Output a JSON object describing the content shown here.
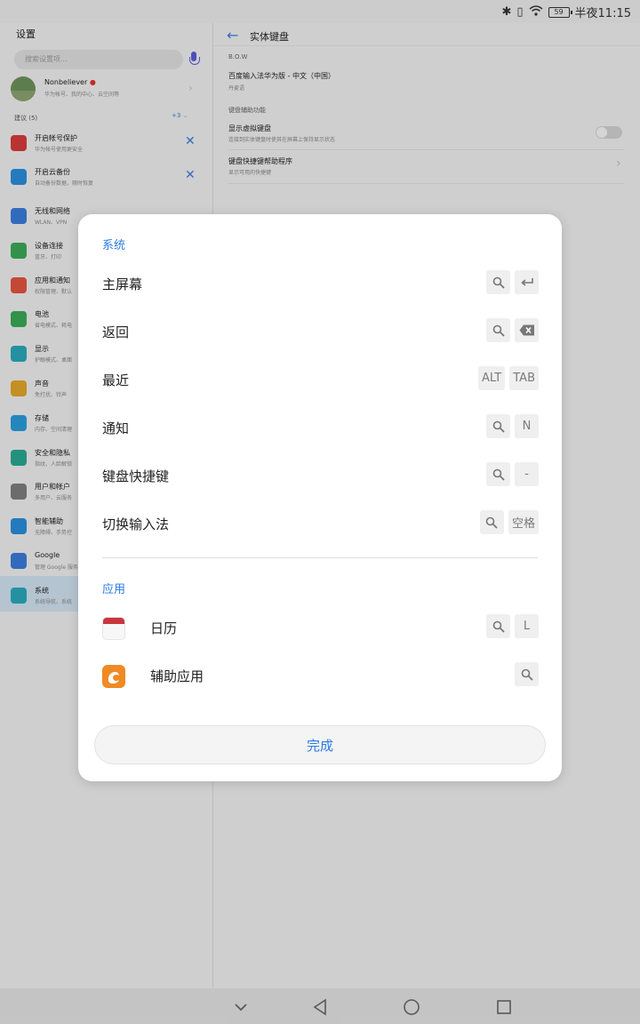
{
  "status_bar": {
    "battery": "59",
    "time": "半夜11:15"
  },
  "left_pane": {
    "title": "设置",
    "search_placeholder": "搜索设置项...",
    "profile": {
      "name": "Nonbeliever",
      "sub": "华为帐号、我的中心、云空间等"
    },
    "suggest": {
      "label": "建议 (5)",
      "more": "+3"
    },
    "suggestions": [
      {
        "title": "开启帐号保护",
        "sub": "华为帐号使用更安全"
      },
      {
        "title": "开启云备份",
        "sub": "自动备份数据，随时恢复"
      }
    ],
    "items": [
      {
        "title": "无线和网络",
        "sub": "WLAN、VPN",
        "color": "#3b7ad6"
      },
      {
        "title": "设备连接",
        "sub": "蓝牙、打印",
        "color": "#3aa756"
      },
      {
        "title": "应用和通知",
        "sub": "权限管理、默认",
        "color": "#e0523f"
      },
      {
        "title": "电池",
        "sub": "省电模式、耗电",
        "color": "#3aa756"
      },
      {
        "title": "显示",
        "sub": "护眼模式、桌面",
        "color": "#2aa6b7"
      },
      {
        "title": "声音",
        "sub": "免打扰、铃声",
        "color": "#e0a32a"
      },
      {
        "title": "存储",
        "sub": "内存、空间清理",
        "color": "#2a9ad6"
      },
      {
        "title": "安全和隐私",
        "sub": "指纹、人脸解锁",
        "color": "#2aa68f"
      },
      {
        "title": "用户和帐户",
        "sub": "多用户、云服务",
        "color": "#7b7b7b"
      },
      {
        "title": "智能辅助",
        "sub": "无障碍、手势控",
        "color": "#2a8bd6"
      },
      {
        "title": "Google",
        "sub": "管理 Google 服务",
        "color": "#3b7ad6"
      },
      {
        "title": "系统",
        "sub": "系统导航、系统",
        "color": "#2aa6b7"
      }
    ]
  },
  "right_pane": {
    "title": "实体键盘",
    "section1": "B.O.W",
    "ime_title": "百度输入法华为版 - 中文（中国）",
    "ime_sub": "丹麦语",
    "section2": "键盘辅助功能",
    "virtual_title": "显示虚拟键盘",
    "virtual_sub": "连接到实体键盘时使其在屏幕上保持显示状态",
    "helper_title": "键盘快捷键帮助程序",
    "helper_sub": "显示可用的快捷键"
  },
  "dialog": {
    "system_title": "系统",
    "shortcuts": [
      {
        "label": "主屏幕",
        "keys": [
          "search",
          "enter"
        ]
      },
      {
        "label": "返回",
        "keys": [
          "search",
          "backspace"
        ]
      },
      {
        "label": "最近",
        "keys": [
          "ALT",
          "TAB"
        ]
      },
      {
        "label": "通知",
        "keys": [
          "search",
          "N"
        ]
      },
      {
        "label": "键盘快捷键",
        "keys": [
          "search",
          "-"
        ]
      },
      {
        "label": "切换输入法",
        "keys": [
          "search",
          "空格"
        ]
      }
    ],
    "apps_title": "应用",
    "apps": [
      {
        "label": "日历",
        "keys": [
          "search",
          "L"
        ],
        "icon": "calendar-icon"
      },
      {
        "label": "辅助应用",
        "keys": [
          "search"
        ],
        "icon": "uc-browser-icon"
      }
    ],
    "done_label": "完成"
  },
  "colors": {
    "accent": "#2c7be5"
  }
}
